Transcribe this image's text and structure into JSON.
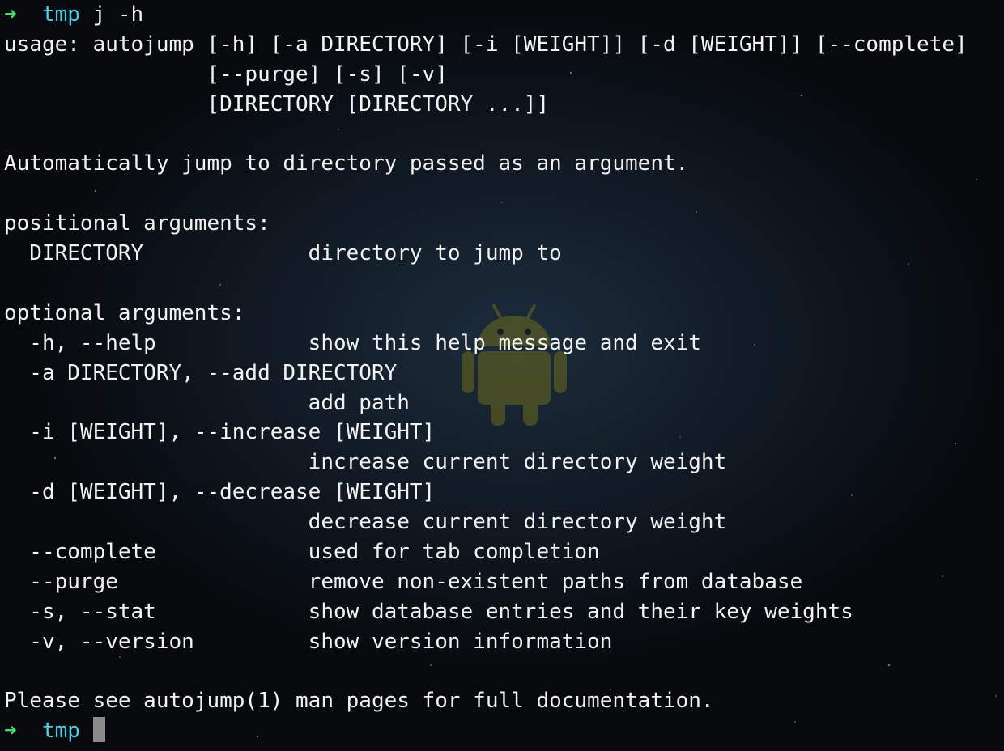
{
  "prompt": {
    "arrow": "➜",
    "directory": "tmp",
    "command": "j -h"
  },
  "output": [
    "usage: autojump [-h] [-a DIRECTORY] [-i [WEIGHT]] [-d [WEIGHT]] [--complete]",
    "                [--purge] [-s] [-v]",
    "                [DIRECTORY [DIRECTORY ...]]",
    "",
    "Automatically jump to directory passed as an argument.",
    "",
    "positional arguments:",
    "  DIRECTORY             directory to jump to",
    "",
    "optional arguments:",
    "  -h, --help            show this help message and exit",
    "  -a DIRECTORY, --add DIRECTORY",
    "                        add path",
    "  -i [WEIGHT], --increase [WEIGHT]",
    "                        increase current directory weight",
    "  -d [WEIGHT], --decrease [WEIGHT]",
    "                        decrease current directory weight",
    "  --complete            used for tab completion",
    "  --purge               remove non-existent paths from database",
    "  -s, --stat            show database entries and their key weights",
    "  -v, --version         show version information",
    "",
    "Please see autojump(1) man pages for full documentation."
  ],
  "final_prompt": {
    "arrow": "➜",
    "directory": "tmp"
  },
  "colors": {
    "prompt_arrow": "#3fe36b",
    "prompt_directory": "#3fd4e8",
    "text": "#f2f2f2",
    "background": "#0b0f14",
    "cursor": "#8a8a8a"
  },
  "background_icon": "android-robot-icon"
}
